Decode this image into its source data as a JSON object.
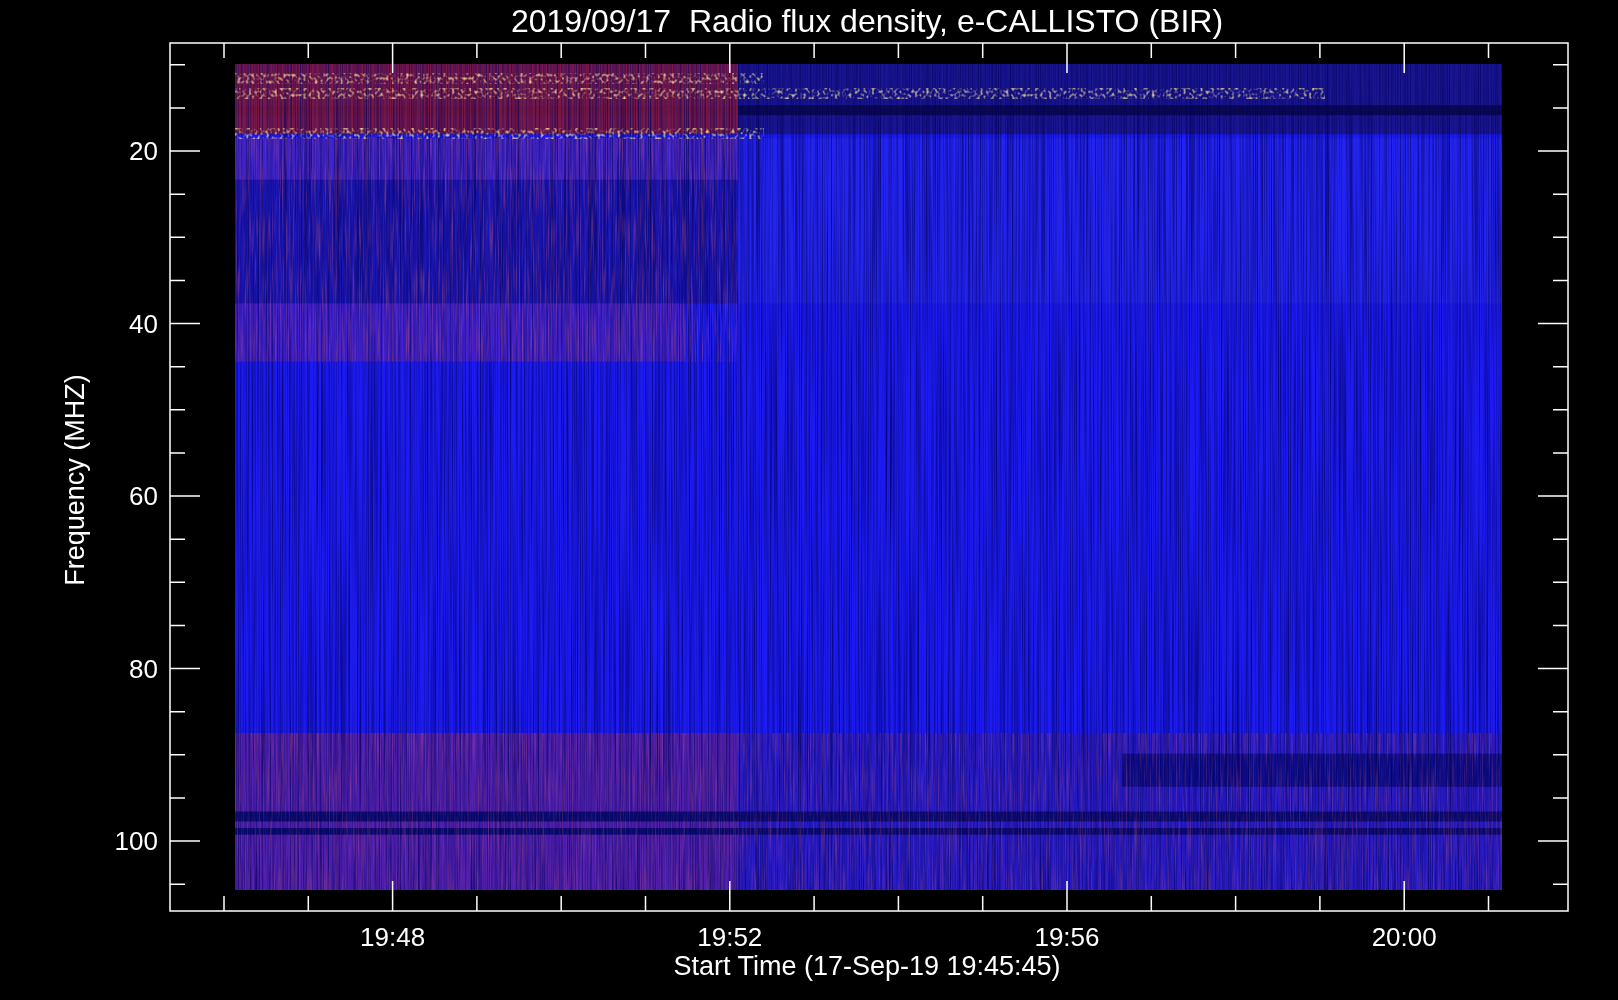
{
  "title": "2019/09/17  Radio flux density, e-CALLISTO (BIR)",
  "y_axis": {
    "label": "Frequency (MHZ)",
    "tick_labels": [
      "20",
      "40",
      "60",
      "80",
      "100"
    ]
  },
  "x_axis": {
    "label": "Start Time (17-Sep-19 19:45:45)",
    "tick_labels": [
      "19:48",
      "19:52",
      "19:56",
      "20:00"
    ]
  }
}
